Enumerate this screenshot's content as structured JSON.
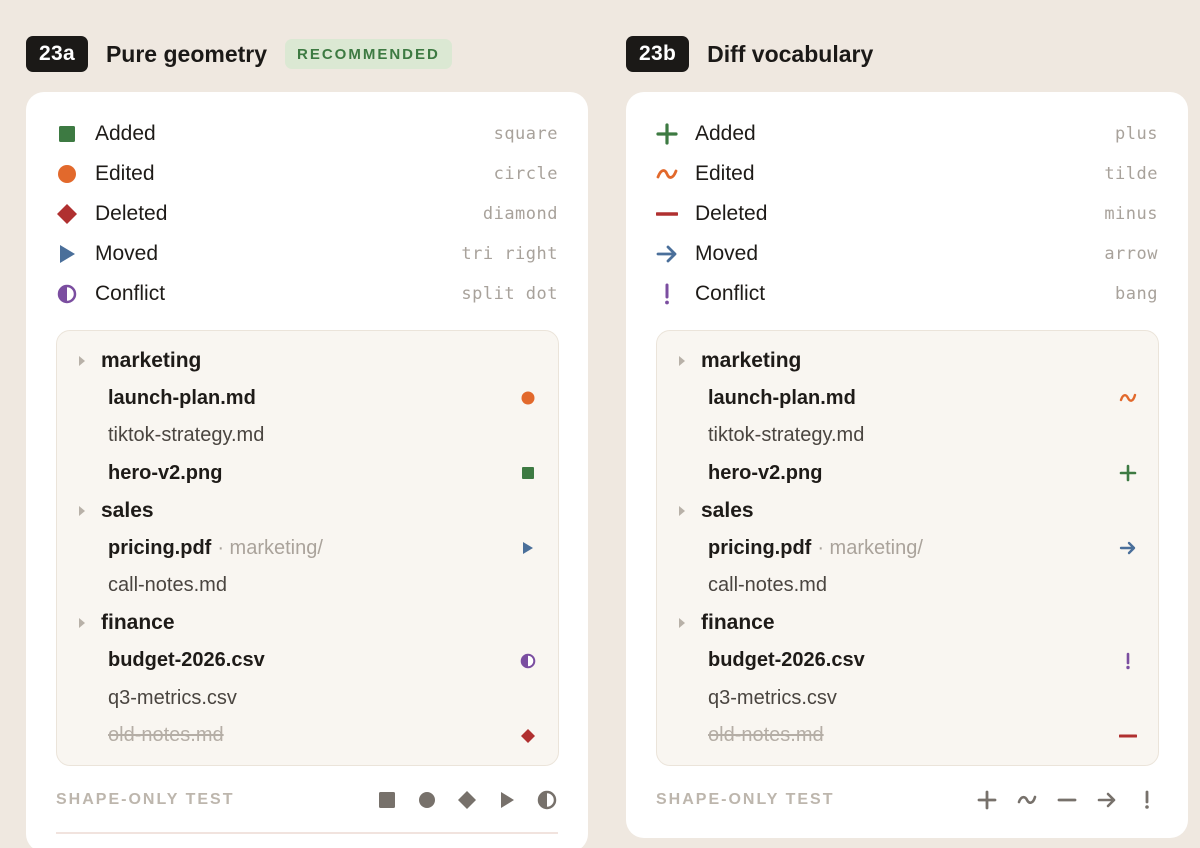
{
  "colors": {
    "added": "#3d7a42",
    "edited": "#e2692c",
    "deleted": "#b03030",
    "moved": "#4a6f9a",
    "conflict": "#7b4ea0",
    "neutral": "#77716b"
  },
  "panel_a": {
    "tag": "23a",
    "title": "Pure geometry",
    "badge": "RECOMMENDED",
    "legend": [
      {
        "label": "Added",
        "code": "square",
        "icon": "square-icon"
      },
      {
        "label": "Edited",
        "code": "circle",
        "icon": "circle-icon"
      },
      {
        "label": "Deleted",
        "code": "diamond",
        "icon": "diamond-icon"
      },
      {
        "label": "Moved",
        "code": "tri right",
        "icon": "triangle-right-icon"
      },
      {
        "label": "Conflict",
        "code": "split dot",
        "icon": "split-dot-icon"
      }
    ],
    "tree": {
      "folders": [
        {
          "name": "marketing"
        },
        {
          "name": "sales"
        },
        {
          "name": "finance"
        }
      ],
      "files": [
        {
          "name": "launch-plan.md",
          "status": "edited"
        },
        {
          "name": "tiktok-strategy.md",
          "status": "none"
        },
        {
          "name": "hero-v2.png",
          "status": "added"
        },
        {
          "name": "pricing.pdf",
          "sub": "· marketing/",
          "status": "moved"
        },
        {
          "name": "call-notes.md",
          "status": "none"
        },
        {
          "name": "budget-2026.csv",
          "status": "conflict"
        },
        {
          "name": "q3-metrics.csv",
          "status": "none"
        },
        {
          "name": "old-notes.md",
          "status": "deleted"
        }
      ]
    },
    "test_label": "SHAPE-ONLY TEST"
  },
  "panel_b": {
    "tag": "23b",
    "title": "Diff vocabulary",
    "legend": [
      {
        "label": "Added",
        "code": "plus",
        "icon": "plus-icon"
      },
      {
        "label": "Edited",
        "code": "tilde",
        "icon": "tilde-icon"
      },
      {
        "label": "Deleted",
        "code": "minus",
        "icon": "minus-icon"
      },
      {
        "label": "Moved",
        "code": "arrow",
        "icon": "arrow-right-icon"
      },
      {
        "label": "Conflict",
        "code": "bang",
        "icon": "exclamation-icon"
      }
    ],
    "tree": {
      "folders": [
        {
          "name": "marketing"
        },
        {
          "name": "sales"
        },
        {
          "name": "finance"
        }
      ],
      "files": [
        {
          "name": "launch-plan.md",
          "status": "edited"
        },
        {
          "name": "tiktok-strategy.md",
          "status": "none"
        },
        {
          "name": "hero-v2.png",
          "status": "added"
        },
        {
          "name": "pricing.pdf",
          "sub": "· marketing/",
          "status": "moved"
        },
        {
          "name": "call-notes.md",
          "status": "none"
        },
        {
          "name": "budget-2026.csv",
          "status": "conflict"
        },
        {
          "name": "q3-metrics.csv",
          "status": "none"
        },
        {
          "name": "old-notes.md",
          "status": "deleted"
        }
      ]
    },
    "test_label": "SHAPE-ONLY TEST"
  }
}
